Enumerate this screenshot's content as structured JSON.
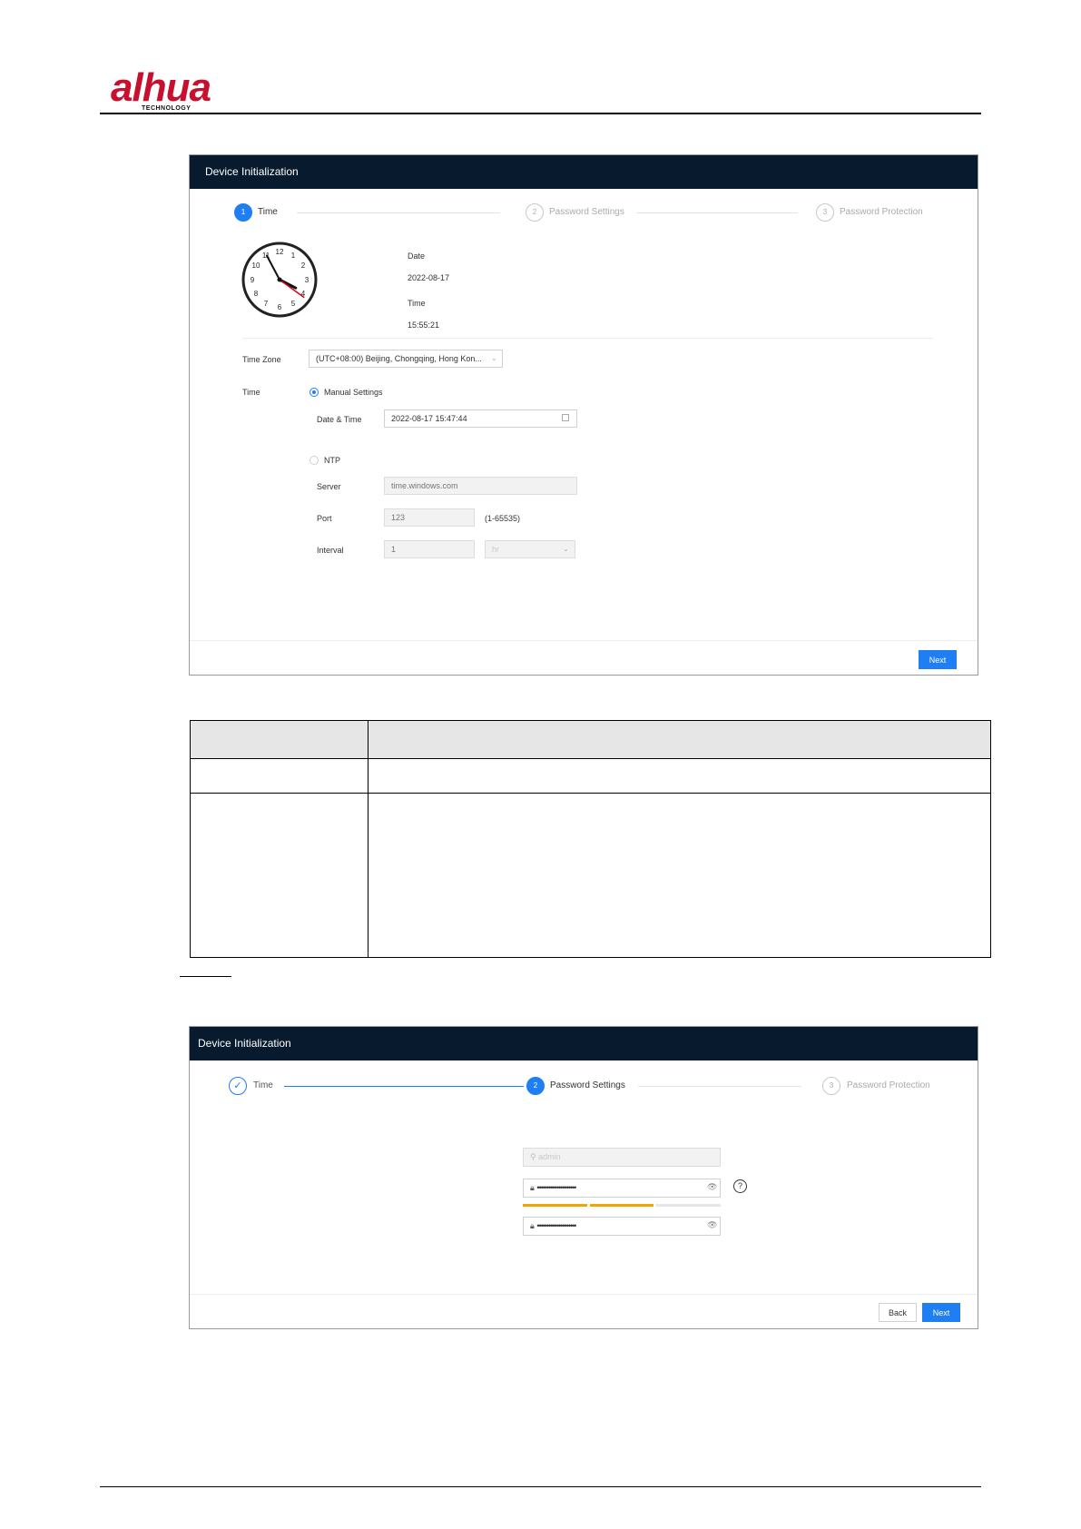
{
  "brand": {
    "logo_text": "alhua",
    "logo_sub": "TECHNOLOGY",
    "logo_color": "#c8102e"
  },
  "screen1": {
    "title": "Device Initialization",
    "steps": [
      {
        "num": "1",
        "label": "Time",
        "state": "active"
      },
      {
        "num": "2",
        "label": "Password Settings",
        "state": "inactive"
      },
      {
        "num": "3",
        "label": "Password Protection",
        "state": "inactive"
      }
    ],
    "clock": {
      "hour": 15,
      "minute": 55,
      "second": 21
    },
    "date_label": "Date",
    "date_value": "2022-08-17",
    "time_label": "Time",
    "time_value": "15:55:21",
    "timezone_label": "Time Zone",
    "timezone_value": "(UTC+08:00) Beijing, Chongqing, Hong Kon...",
    "time_row_label": "Time",
    "manual_label": "Manual Settings",
    "datetime_label": "Date & Time",
    "datetime_value": "2022-08-17 15:47:44",
    "ntp_label": "NTP",
    "server_label": "Server",
    "server_placeholder": "time.windows.com",
    "port_label": "Port",
    "port_placeholder": "123",
    "port_range": "(1-65535)",
    "interval_label": "Interval",
    "interval_placeholder": "1",
    "interval_unit": "hr",
    "next_label": "Next"
  },
  "screen2": {
    "title": "Device Initialization",
    "steps": [
      {
        "num": "✓",
        "label": "Time",
        "state": "done"
      },
      {
        "num": "2",
        "label": "Password Settings",
        "state": "active"
      },
      {
        "num": "3",
        "label": "Password Protection",
        "state": "inactive"
      }
    ],
    "username_placeholder": "admin",
    "password_mask": "••••••••••••••••••••",
    "confirm_mask": "••••••••••••••••••••",
    "strength_level": 0.67,
    "strength_color": "#f0a500",
    "back_label": "Back",
    "next_label": "Next"
  },
  "colors": {
    "accent": "#1f7ef2",
    "titlebar": "#071a2e"
  }
}
